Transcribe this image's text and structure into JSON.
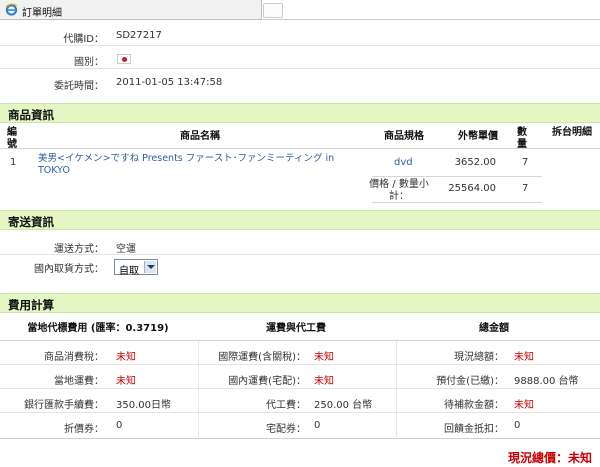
{
  "window": {
    "tab_title": "訂單明細"
  },
  "order": {
    "id_label": "代購ID：",
    "id_value": "SD27217",
    "country_label": "國別：",
    "time_label": "委託時間：",
    "time_value": "2011-01-05 13:47:58"
  },
  "product_section": {
    "title": "商品資訊",
    "headers": {
      "no": "編號",
      "name": "商品名稱",
      "spec": "商品規格",
      "unit_price": "外幣單價",
      "qty": "數量",
      "detail": "拆台明細"
    },
    "rows": [
      {
        "no": "1",
        "name": "美男<イケメン>ですね Presents ファースト･ファンミーティング in TOKYO",
        "spec": "dvd",
        "unit_price": "3652.00",
        "qty": "7"
      }
    ],
    "subtotal_label": "價格 / 數量小計：",
    "subtotal_value": "25564.00",
    "subtotal_qty": "7"
  },
  "shipping_section": {
    "title": "寄送資訊",
    "method_label": "運送方式：",
    "method_value": "空運",
    "pickup_label": "國內取貨方式：",
    "pickup_selected": "自取"
  },
  "cost_section": {
    "title": "費用計算",
    "col1_header": "當地代標費用 (匯率：0.3719)",
    "col2_header": "運費與代工費",
    "col3_header": "總金額",
    "rows": [
      {
        "l1": "商品消費稅：",
        "v1": "未知",
        "l2": "國際運費(含關稅)：",
        "v2": "未知",
        "l3": "現況總額：",
        "v3": "未知"
      },
      {
        "l1": "當地運費：",
        "v1": "未知",
        "l2": "國內運費(宅配)：",
        "v2": "未知",
        "l3": "預付金(已繳)：",
        "v3": "9888.00 台幣"
      },
      {
        "l1": "銀行匯款手續費：",
        "v1": "350.00日幣",
        "l2": "代工費：",
        "v2": "250.00 台幣",
        "l3": "待補款金額：",
        "v3": "未知"
      },
      {
        "l1": "折價券：",
        "v1": "0",
        "l2": "宅配券：",
        "v2": "0",
        "l3": "回饋金抵扣：",
        "v3": "0"
      }
    ],
    "total_label": "現況總價：未知"
  },
  "colors": {
    "section_bg": "#e3f6c4",
    "unknown_red": "#cc0000",
    "link_blue": "#2e5fa0"
  },
  "icons": {
    "browser": "ie-icon",
    "flag": "japan-flag-icon"
  }
}
